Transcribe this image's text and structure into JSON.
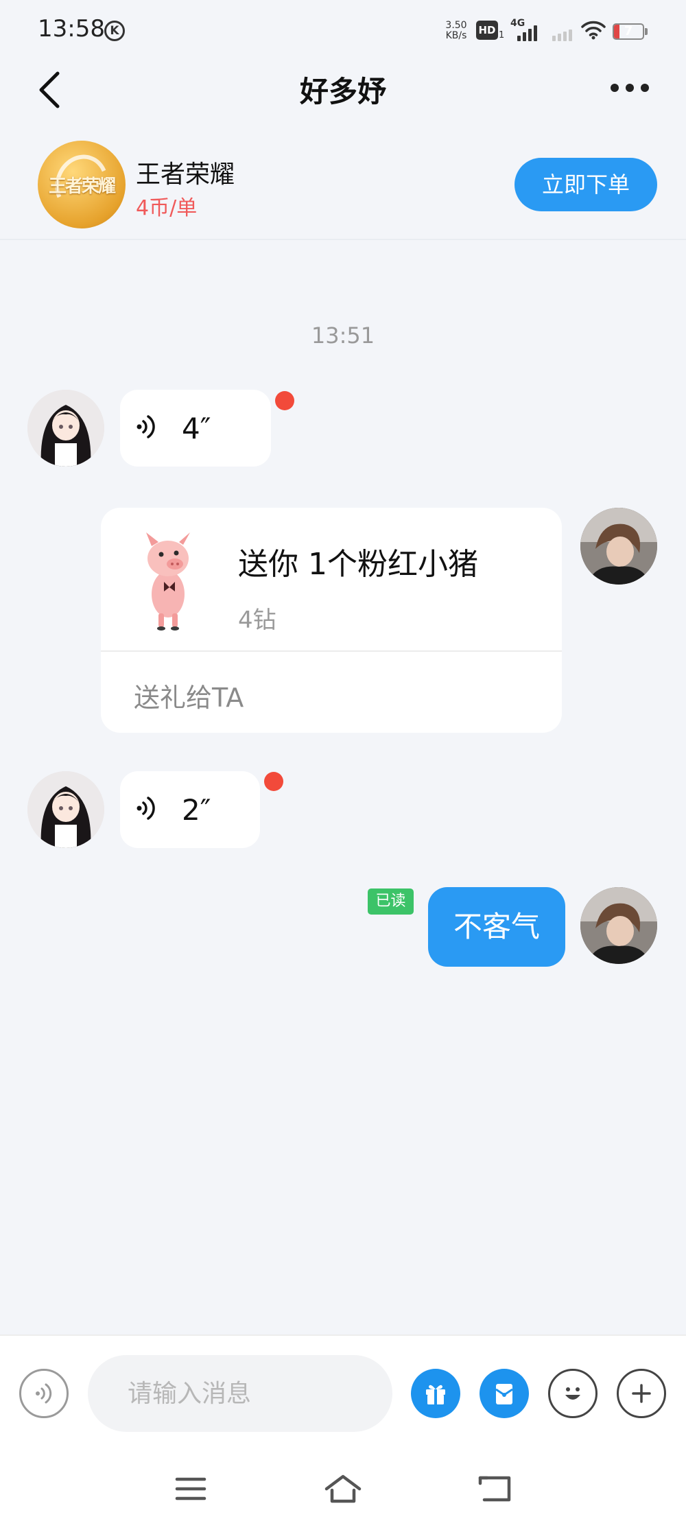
{
  "status_bar": {
    "time": "13:58",
    "k_badge": "K",
    "net_speed": "3.50",
    "net_speed_unit": "KB/s",
    "hd_label": "HD",
    "hd_sub": "1",
    "network": "4G",
    "battery": "7",
    "battery_level": 0.07
  },
  "header": {
    "title": "好多妤",
    "back_icon": "chevron-left-icon",
    "more_icon": "more-dots-icon"
  },
  "game": {
    "logo_text": "王者荣耀",
    "name": "王者荣耀",
    "price": "4币/单",
    "order_button": "立即下单"
  },
  "chat": {
    "timestamp": "13:51",
    "messages": [
      {
        "sender": "other",
        "type": "voice",
        "duration": "4″",
        "unread": true
      },
      {
        "sender": "me",
        "type": "gift",
        "title": "送你 1个粉红小猪",
        "price": "4钻",
        "action": "送礼给TA"
      },
      {
        "sender": "other",
        "type": "voice",
        "duration": "2″",
        "unread": true
      },
      {
        "sender": "me",
        "type": "text",
        "text": "不客气",
        "status": "已读"
      }
    ]
  },
  "input": {
    "placeholder": "请输入消息",
    "icons": [
      "voice-icon",
      "gift-icon",
      "red-packet-icon",
      "emoji-icon",
      "plus-icon"
    ]
  },
  "nav": {
    "icons": [
      "menu-icon",
      "home-icon",
      "back-nav-icon"
    ]
  },
  "colors": {
    "accent": "#2a9af3",
    "price_red": "#f05a5a",
    "unread_dot": "#f24a3a",
    "read_badge": "#3cc368",
    "background": "#f3f5f9"
  }
}
